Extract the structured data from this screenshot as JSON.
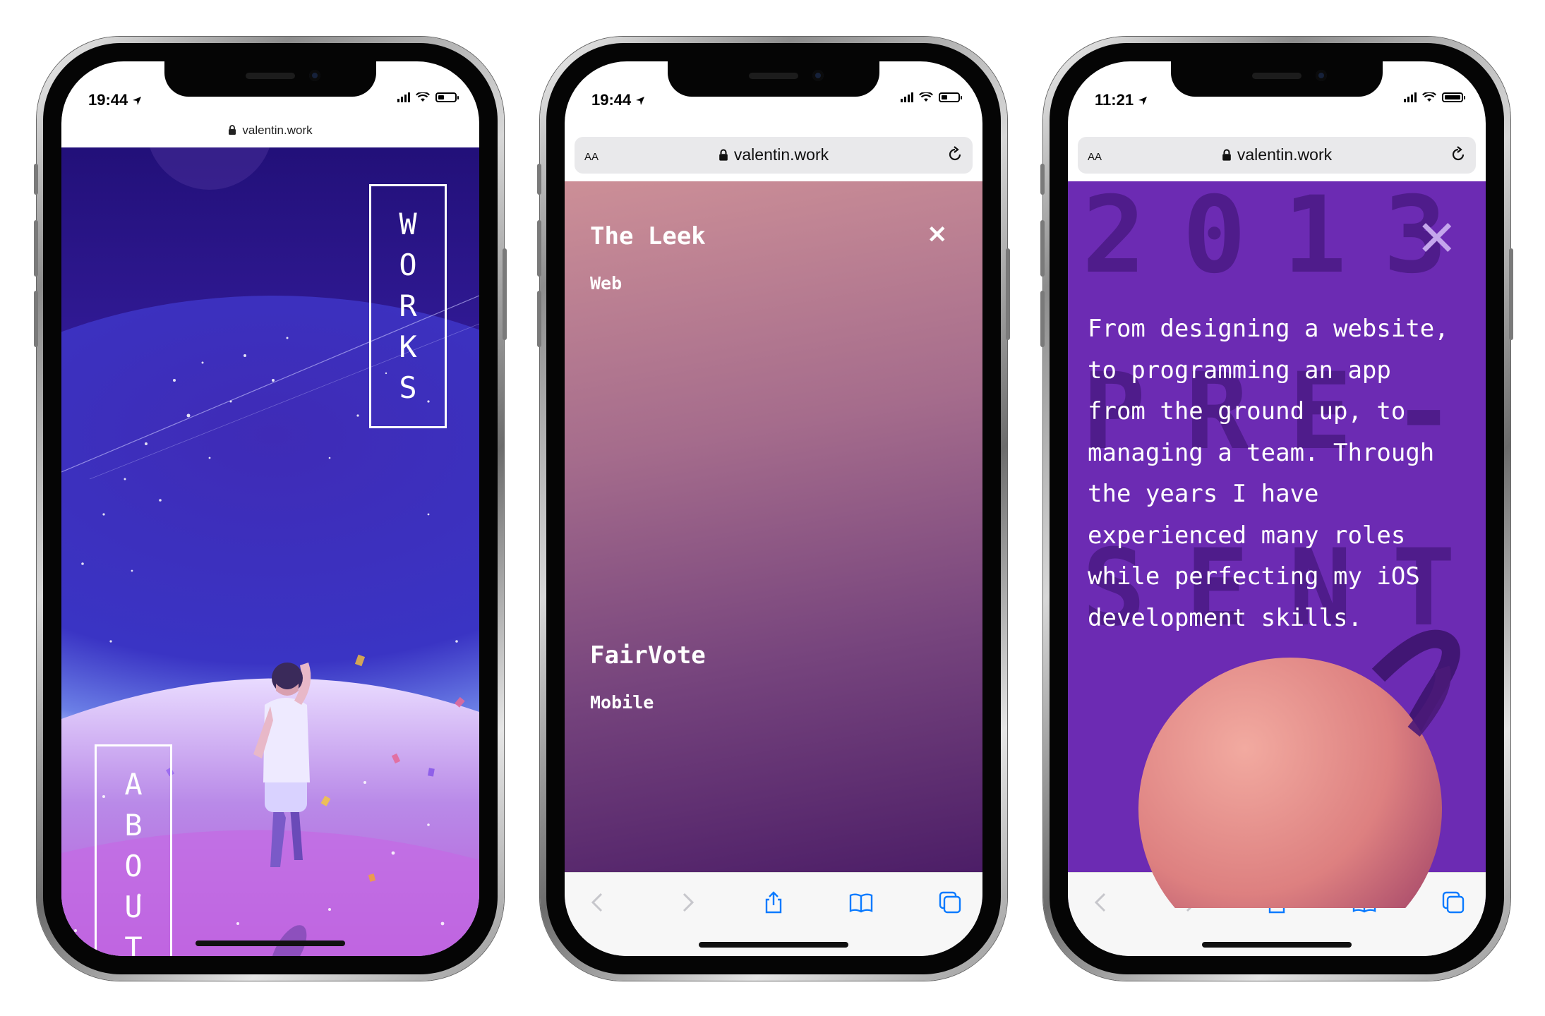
{
  "phones": [
    {
      "time": "19:44",
      "url": "valentin.work",
      "nav": {
        "works_letters": [
          "W",
          "O",
          "R",
          "K",
          "S"
        ],
        "about_letters": [
          "A",
          "B",
          "O",
          "U",
          "T"
        ]
      }
    },
    {
      "time": "19:44",
      "url": "valentin.work",
      "text_size_label": "AA",
      "projects": [
        {
          "title": "The Leek",
          "category": "Web"
        },
        {
          "title": "FairVote",
          "category": "Mobile"
        }
      ],
      "close_symbol": "✕"
    },
    {
      "time": "11:21",
      "url": "valentin.work",
      "text_size_label": "AA",
      "background_year": "2013",
      "background_word_lines": [
        "PRE-",
        "SENT"
      ],
      "about_lines": [
        "From designing a website,",
        "to programming an app",
        "from the ground up, to",
        "managing a team. Through",
        "the years I have",
        "experienced many roles",
        "while perfecting my iOS",
        "development skills."
      ],
      "close_symbol": "✕"
    }
  ],
  "colors": {
    "space_top": "#2a1690",
    "space_mid": "#4b2bc2",
    "pink_top": "#c98b93",
    "plum_bottom": "#4a1a63",
    "about_purple": "#6c2bb3",
    "planet": "#e08d86",
    "toolbar_icon": "#0a7aff"
  },
  "icons": [
    "location-arrow-icon",
    "signal-icon",
    "wifi-icon",
    "battery-icon",
    "lock-icon",
    "reload-icon",
    "back-icon",
    "forward-icon",
    "share-icon",
    "bookmarks-icon",
    "tabs-icon",
    "close-icon"
  ]
}
